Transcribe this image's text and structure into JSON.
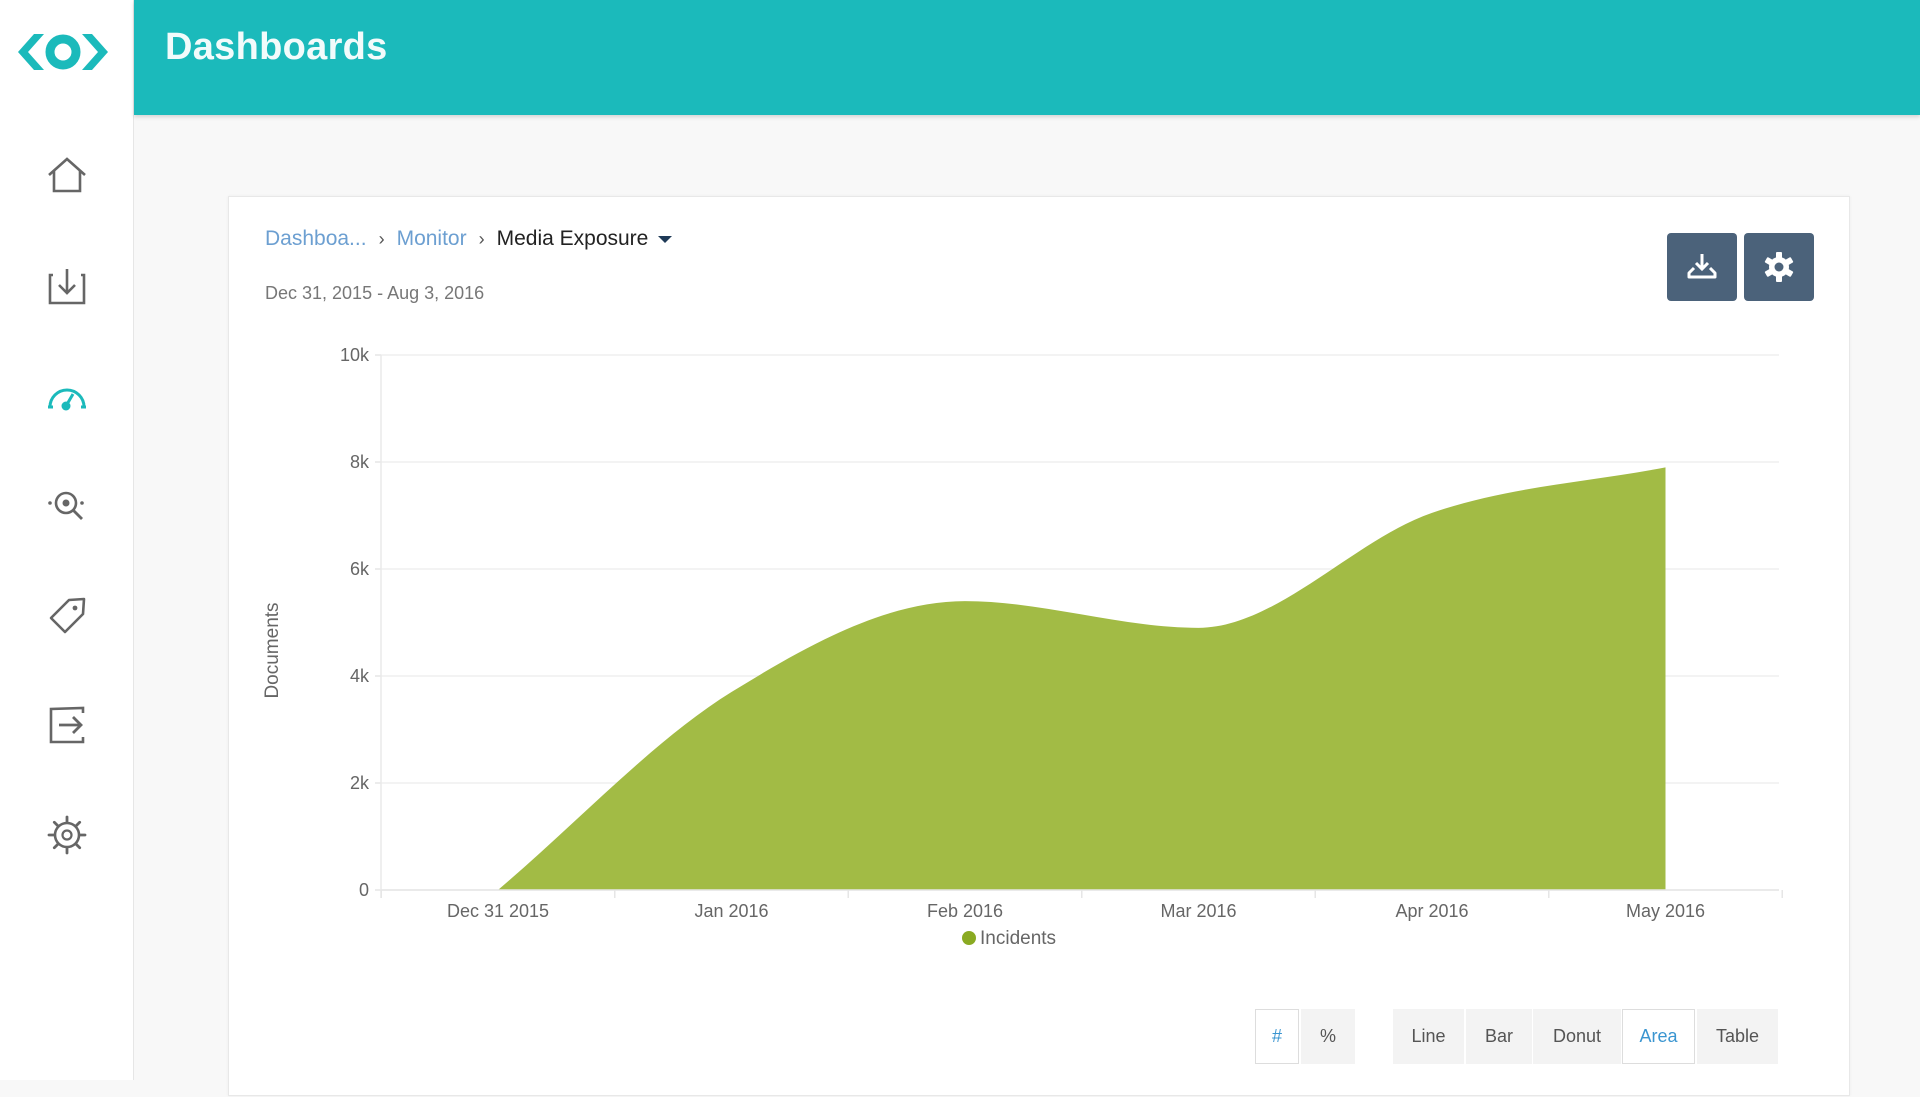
{
  "app": {
    "logo": "eye-logo",
    "header_title": "Dashboards"
  },
  "sidebar": {
    "items": [
      {
        "name": "home",
        "icon": "home-icon",
        "active": false
      },
      {
        "name": "inbox",
        "icon": "inbox-download-icon",
        "active": false
      },
      {
        "name": "dashboards",
        "icon": "gauge-icon",
        "active": true
      },
      {
        "name": "search",
        "icon": "search-scan-icon",
        "active": false
      },
      {
        "name": "tags",
        "icon": "tag-icon",
        "active": false
      },
      {
        "name": "export",
        "icon": "export-icon",
        "active": false
      },
      {
        "name": "settings",
        "icon": "gear-icon",
        "active": false
      }
    ],
    "active_color": "#1bbabb",
    "icon_color": "#666666"
  },
  "card": {
    "breadcrumb": {
      "items": [
        "Dashboa...",
        "Monitor"
      ],
      "separator": "›",
      "current": "Media Exposure"
    },
    "date_range": "Dec 31, 2015 - Aug 3, 2016",
    "toolbar": {
      "download_icon": "download-tray-icon",
      "settings_icon": "gear-icon"
    },
    "value_mode": {
      "options": [
        "#",
        "%"
      ],
      "selected": "#"
    },
    "chart_types": {
      "options": [
        "Line",
        "Bar",
        "Donut",
        "Area",
        "Table"
      ],
      "selected": "Area"
    }
  },
  "chart_data": {
    "type": "area",
    "title": "",
    "xlabel": "",
    "ylabel": "Documents",
    "categories": [
      "Dec 31 2015",
      "Jan 2016",
      "Feb 2016",
      "Mar 2016",
      "Apr 2016",
      "May 2016"
    ],
    "series": [
      {
        "name": "Incidents",
        "color": "#a2bb45",
        "legend_color": "#8aaa22",
        "values": [
          0,
          3700,
          5400,
          4900,
          7050,
          7900
        ]
      }
    ],
    "ylim": [
      0,
      10000
    ],
    "yticks": [
      0,
      2000,
      4000,
      6000,
      8000,
      10000
    ],
    "ytick_labels": [
      "0",
      "2k",
      "4k",
      "6k",
      "8k",
      "10k"
    ],
    "grid": true,
    "legend": "bottom-center"
  }
}
